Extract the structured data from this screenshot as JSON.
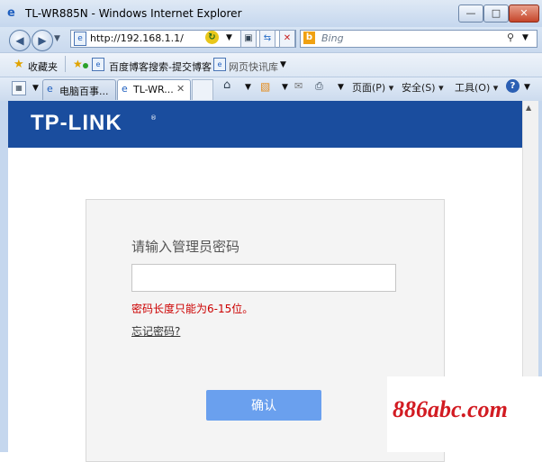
{
  "window": {
    "icon": "ie-icon",
    "title": "TL-WR885N - Windows Internet Explorer",
    "min": "—",
    "max": "□",
    "close": "✕"
  },
  "address": {
    "url": "http://192.168.1.1/",
    "search_placeholder": "Bing"
  },
  "favorites": {
    "label": "收藏夹",
    "links": [
      "百度博客搜索-提交博客",
      "网页快讯库"
    ]
  },
  "tabs": [
    {
      "label": "电脑百事...",
      "active": false
    },
    {
      "label": "TL-WR...",
      "active": true
    }
  ],
  "commands": {
    "page": "页面(P)",
    "safety": "安全(S)",
    "tools": "工具(O)"
  },
  "router_page": {
    "logo": "TP-LINK",
    "logo_mark": "®",
    "heading": "请输入管理员密码",
    "password_value": "",
    "hint": "密码长度只能为6-15位。",
    "forgot": "忘记密码?",
    "confirm": "确认"
  },
  "watermark": "886abc.com",
  "colors": {
    "banner": "#1a4d9e",
    "button": "#6aa0ee",
    "hint": "#cc0000",
    "watermark": "#d21b22"
  }
}
